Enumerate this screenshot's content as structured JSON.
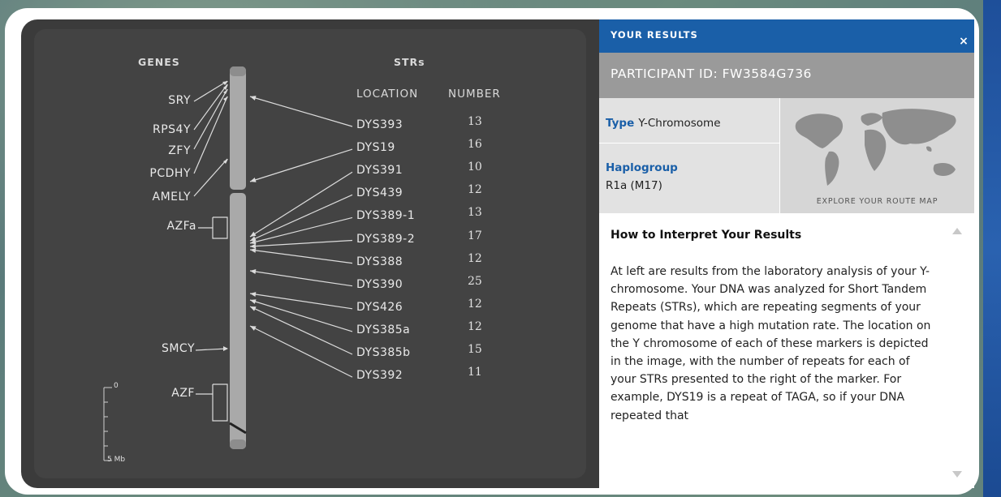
{
  "chart": {
    "genes_header": "GENES",
    "strs_header": "STRs",
    "location_header": "LOCATION",
    "number_header": "NUMBER",
    "genes": [
      "SRY",
      "RPS4Y",
      "ZFY",
      "PCDHY",
      "AMELY"
    ],
    "gene_regions": [
      "AZFa",
      "SMCY",
      "AZF"
    ],
    "scale_top": "0",
    "scale_bottom": "5 Mb",
    "strs": [
      {
        "location": "DYS393",
        "number": "13"
      },
      {
        "location": "DYS19",
        "number": "16"
      },
      {
        "location": "DYS391",
        "number": "10"
      },
      {
        "location": "DYS439",
        "number": "12"
      },
      {
        "location": "DYS389-1",
        "number": "13"
      },
      {
        "location": "DYS389-2",
        "number": "17"
      },
      {
        "location": "DYS388",
        "number": "12"
      },
      {
        "location": "DYS390",
        "number": "25"
      },
      {
        "location": "DYS426",
        "number": "12"
      },
      {
        "location": "DYS385a",
        "number": "12"
      },
      {
        "location": "DYS385b",
        "number": "15"
      },
      {
        "location": "DYS392",
        "number": "11"
      }
    ]
  },
  "side": {
    "results_title": "YOUR RESULTS",
    "close_label": "×",
    "participant": "PARTICIPANT ID: FW3584G736",
    "type_key": "Type",
    "type_value": "Y-Chromosome",
    "haplogroup_key": "Haplogroup",
    "haplogroup_value": "R1a (M17)",
    "map_caption": "EXPLORE YOUR ROUTE MAP",
    "interp_title": "How to Interpret Your Results",
    "interp_body": "At left are results from the laboratory analysis of your Y-chromosome. Your DNA was analyzed for Short Tandem Repeats (STRs), which are repeating segments of your genome that have a high mutation rate. The location on the Y chromosome of each of these markers is depicted in the image, with the number of repeats for each of your STRs presented to the right of the marker. For example, DYS19 is a repeat of TAGA, so if your DNA repeated that"
  },
  "colors": {
    "accent": "#1a5fa8",
    "chart_bg": "#3b3b3b",
    "participant_bg": "#9a9a9a"
  },
  "icons": [
    "close-icon",
    "scroll-up-icon",
    "scroll-down-icon",
    "world-map-icon"
  ]
}
